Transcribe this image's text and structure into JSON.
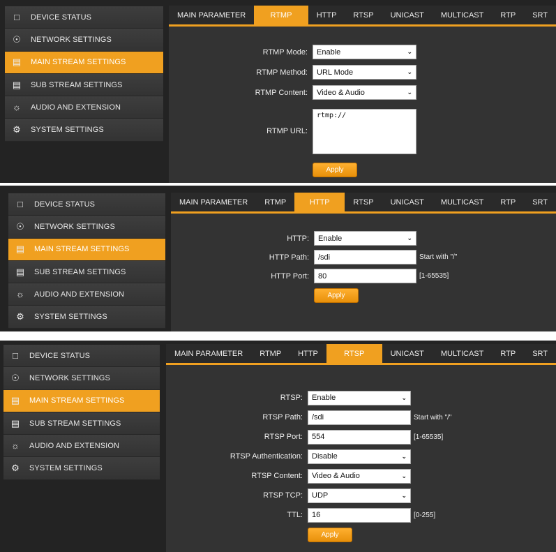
{
  "sidebar": {
    "items": [
      {
        "label": "DEVICE STATUS",
        "icon": "monitor-icon"
      },
      {
        "label": "NETWORK SETTINGS",
        "icon": "globe-icon"
      },
      {
        "label": "MAIN STREAM SETTINGS",
        "icon": "stream-icon"
      },
      {
        "label": "SUB STREAM SETTINGS",
        "icon": "stream-icon"
      },
      {
        "label": "AUDIO AND EXTENSION",
        "icon": "audio-gear-icon"
      },
      {
        "label": "SYSTEM SETTINGS",
        "icon": "gear-icon"
      }
    ],
    "active": 2
  },
  "tabs": [
    "MAIN PARAMETER",
    "RTMP",
    "HTTP",
    "RTSP",
    "UNICAST",
    "MULTICAST",
    "RTP",
    "SRT"
  ],
  "accent": "#f0a020",
  "panels": [
    {
      "active_tab": 1,
      "apply": "Apply",
      "fields": [
        {
          "label": "RTMP Mode:",
          "type": "select",
          "value": "Enable"
        },
        {
          "label": "RTMP Method:",
          "type": "select",
          "value": "URL Mode"
        },
        {
          "label": "RTMP Content:",
          "type": "select",
          "value": "Video & Audio"
        },
        {
          "label": "RTMP URL:",
          "type": "textarea",
          "value": "rtmp://"
        }
      ]
    },
    {
      "active_tab": 2,
      "apply": "Apply",
      "fields": [
        {
          "label": "HTTP:",
          "type": "select",
          "value": "Enable"
        },
        {
          "label": "HTTP Path:",
          "type": "input",
          "value": "/sdi",
          "hint": "Start with \"/\""
        },
        {
          "label": "HTTP Port:",
          "type": "input",
          "value": "80",
          "hint": "[1-65535]"
        }
      ]
    },
    {
      "active_tab": 3,
      "apply": "Apply",
      "fields": [
        {
          "label": "RTSP:",
          "type": "select",
          "value": "Enable"
        },
        {
          "label": "RTSP Path:",
          "type": "input",
          "value": "/sdi",
          "hint": "Start with \"/\""
        },
        {
          "label": "RTSP Port:",
          "type": "input",
          "value": "554",
          "hint": "[1-65535]"
        },
        {
          "label": "RTSP Authentication:",
          "type": "select",
          "value": "Disable"
        },
        {
          "label": "RTSP Content:",
          "type": "select",
          "value": "Video & Audio"
        },
        {
          "label": "RTSP TCP:",
          "type": "select",
          "value": "UDP"
        },
        {
          "label": "TTL:",
          "type": "input",
          "value": "16",
          "hint": "[0-255]"
        }
      ]
    }
  ]
}
